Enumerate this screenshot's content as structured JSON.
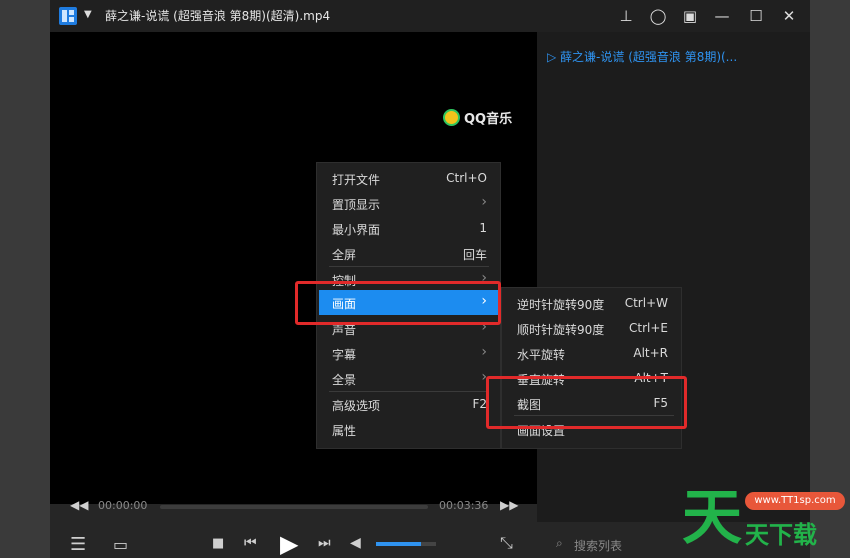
{
  "window": {
    "title": "薛之谦-说谎 (超强音浪 第8期)(超清).mp4"
  },
  "playlist": {
    "item": "薛之谦-说谎 (超强音浪 第8期)(...",
    "search_placeholder": "搜索列表"
  },
  "watermark": "QQ音乐",
  "context_menu": {
    "items": [
      {
        "label": "打开文件",
        "shortcut": "Ctrl+O"
      },
      {
        "label": "置顶显示",
        "shortcut": "›"
      },
      {
        "label": "最小界面",
        "shortcut": "1"
      },
      {
        "label": "全屏",
        "shortcut": "回车"
      },
      {
        "label": "控制",
        "shortcut": "›"
      },
      {
        "label": "画面",
        "shortcut": "›"
      },
      {
        "label": "声音",
        "shortcut": "›"
      },
      {
        "label": "字幕",
        "shortcut": "›"
      },
      {
        "label": "全景",
        "shortcut": "›"
      },
      {
        "label": "高级选项",
        "shortcut": "F2"
      },
      {
        "label": "属性",
        "shortcut": ""
      }
    ]
  },
  "submenu": {
    "items": [
      {
        "label": "逆时针旋转90度",
        "shortcut": "Ctrl+W"
      },
      {
        "label": "顺时针旋转90度",
        "shortcut": "Ctrl+E"
      },
      {
        "label": "水平旋转",
        "shortcut": "Alt+R"
      },
      {
        "label": "垂直旋转",
        "shortcut": "Alt+T"
      },
      {
        "label": "截图",
        "shortcut": "F5"
      },
      {
        "label": "画面设置",
        "shortcut": ""
      }
    ]
  },
  "player": {
    "current_time": "00:00:00",
    "total_time": "00:03:36",
    "volume_fraction": 0.75
  },
  "site_badge": {
    "url": "www.TT1sp.com",
    "char": "天",
    "name": "天下载"
  },
  "colors": {
    "accent": "#1c8cf0",
    "highlight_box": "#e12a2a"
  }
}
